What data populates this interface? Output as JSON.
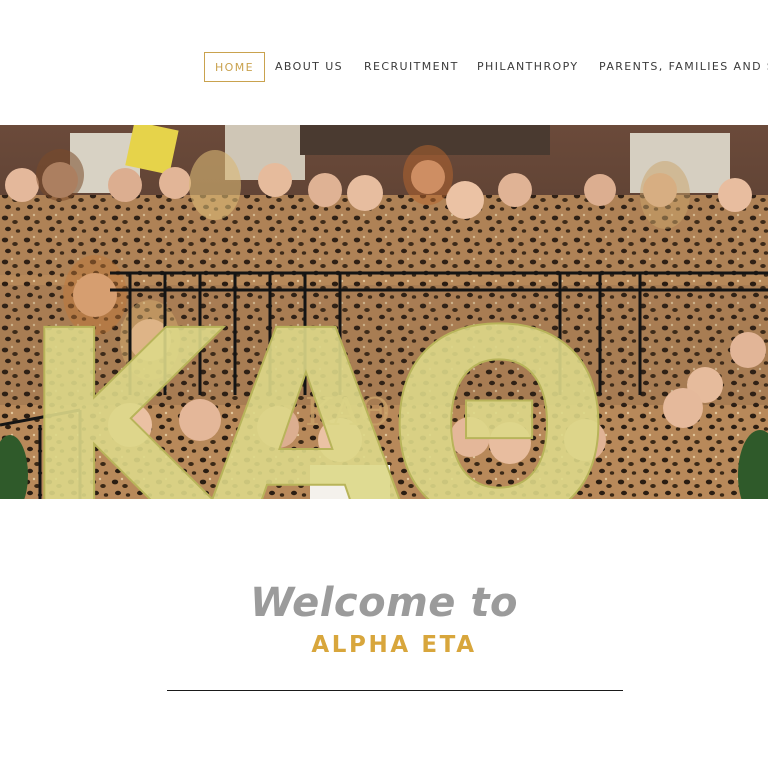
{
  "nav": {
    "items": [
      {
        "label": "HOME",
        "active": true
      },
      {
        "label": "ABOUT US"
      },
      {
        "label": "RECRUITMENT"
      },
      {
        "label": "PHILANTHROPY"
      },
      {
        "label": "PARENTS, FAMILIES AND S"
      }
    ]
  },
  "hero": {
    "letters": "KAΘ",
    "plaque": "KAΘ"
  },
  "main": {
    "welcome": "Welcome to",
    "chapter_name": "ALPHA ETA"
  },
  "colors": {
    "accent_gold": "#c9a24e",
    "chapter_gold": "#d8a63c",
    "welcome_grey": "#9b9b9b",
    "nav_text": "#3b3b3b"
  }
}
